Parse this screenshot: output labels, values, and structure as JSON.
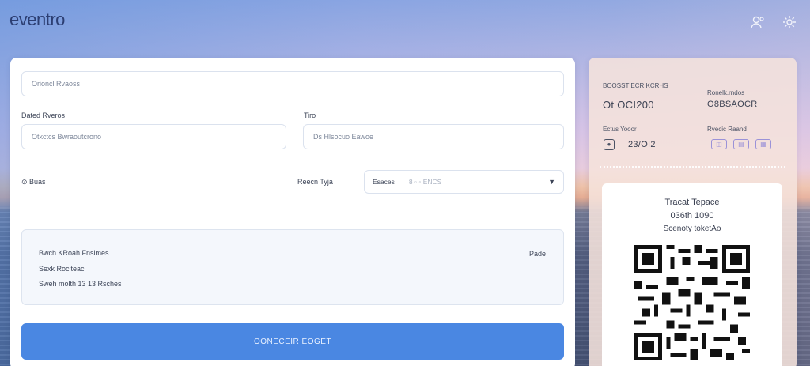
{
  "app": {
    "name": "eventro"
  },
  "header": {
    "icons": [
      "profile-icon",
      "settings-icon"
    ]
  },
  "form": {
    "event_field": {
      "placeholder": "Orioncl Rvaoss"
    },
    "date": {
      "label": "Dated Rveros",
      "placeholder": "Otkctcs Bwraoutcrono"
    },
    "time": {
      "label": "Tiro",
      "placeholder": "Ds Hlsocuo Eawoe"
    },
    "guests": {
      "label": "⊙ Buas"
    },
    "ticket_type": {
      "label": "Reecn Tyja",
      "selected": "Esaces",
      "sub": "8 ◦ ◦ ENCS"
    },
    "summary": {
      "lines": [
        "Bwch  KRoah  Fnsimes",
        "Sexk  Rociteac",
        "Sweh  molth  13  13  Rsches"
      ],
      "price": "Pade"
    },
    "cta_label": "OONECEIR EOGET"
  },
  "ticket": {
    "event": {
      "label": "BOOSST ECR KCRHS",
      "value": "Ot  OCI200"
    },
    "section": {
      "label": "Ronelk.rndos",
      "value": "O8BSAOCR"
    },
    "date": {
      "label": "Ectus  Yooor",
      "value": "23/OI2"
    },
    "seat": {
      "label": "Rvecic  Raand"
    },
    "qr": {
      "title": "Tracat  Tepace",
      "code": "036th  1090",
      "caption": "Scenoty  toketAo"
    }
  }
}
